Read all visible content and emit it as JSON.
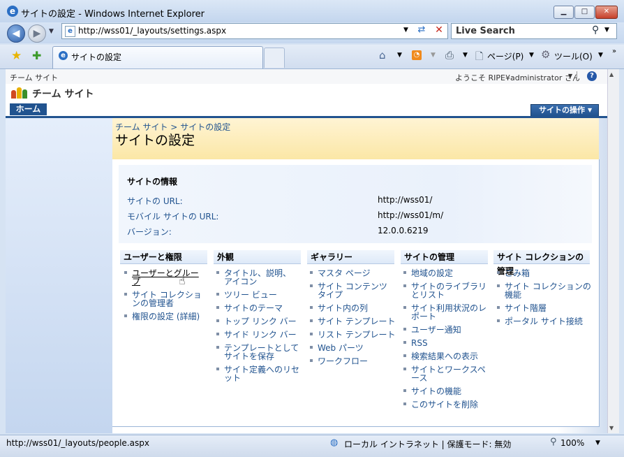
{
  "window": {
    "title": "サイトの設定 - Windows Internet Explorer"
  },
  "browser": {
    "address_url": "http://wss01/_layouts/settings.aspx",
    "search_placeholder": "Live Search",
    "tab_title": "サイトの設定",
    "page_menu": "ページ(P)",
    "tools_menu": "ツール(O)"
  },
  "sp": {
    "top_site_name": "チーム サイト",
    "welcome": "ようこそ RIPE¥administrator さん",
    "site_title": "チーム サイト",
    "home_tab": "ホーム",
    "site_actions": "サイトの操作",
    "breadcrumb": [
      "チーム サイト",
      "サイトの設定"
    ],
    "breadcrumb_sep": ">",
    "page_title": "サイトの設定"
  },
  "site_info": {
    "heading": "サイトの情報",
    "rows": [
      {
        "label": "サイトの URL:",
        "value": "http://wss01/"
      },
      {
        "label": "モバイル サイトの URL:",
        "value": "http://wss01/m/"
      },
      {
        "label": "バージョン:",
        "value": "12.0.0.6219"
      }
    ]
  },
  "categories": [
    {
      "title": "ユーザーと権限",
      "items": [
        "ユーザーとグループ",
        "サイト コレクションの管理者",
        "権限の設定 (詳細)"
      ]
    },
    {
      "title": "外観",
      "items": [
        "タイトル、説明、アイコン",
        "ツリー ビュー",
        "サイトのテーマ",
        "トップ リンク バー",
        "サイド リンク バー",
        "テンプレートとしてサイトを保存",
        "サイト定義へのリセット"
      ]
    },
    {
      "title": "ギャラリー",
      "items": [
        "マスタ ページ",
        "サイト コンテンツ タイプ",
        "サイト内の列",
        "サイト テンプレート",
        "リスト テンプレート",
        "Web パーツ",
        "ワークフロー"
      ]
    },
    {
      "title": "サイトの管理",
      "items": [
        "地域の設定",
        "サイトのライブラリとリスト",
        "サイト利用状況のレポート",
        "ユーザー通知",
        "RSS",
        "検索結果への表示",
        "サイトとワークスペース",
        "サイトの機能",
        "このサイトを削除"
      ]
    },
    {
      "title": "サイト コレクションの管理",
      "items": [
        "ごみ箱",
        "サイト コレクションの機能",
        "サイト階層",
        "ポータル サイト接続"
      ]
    }
  ],
  "status": {
    "url": "http://wss01/_layouts/people.aspx",
    "zone": "ローカル イントラネット | 保護モード: 無効",
    "zoom": "100%"
  }
}
